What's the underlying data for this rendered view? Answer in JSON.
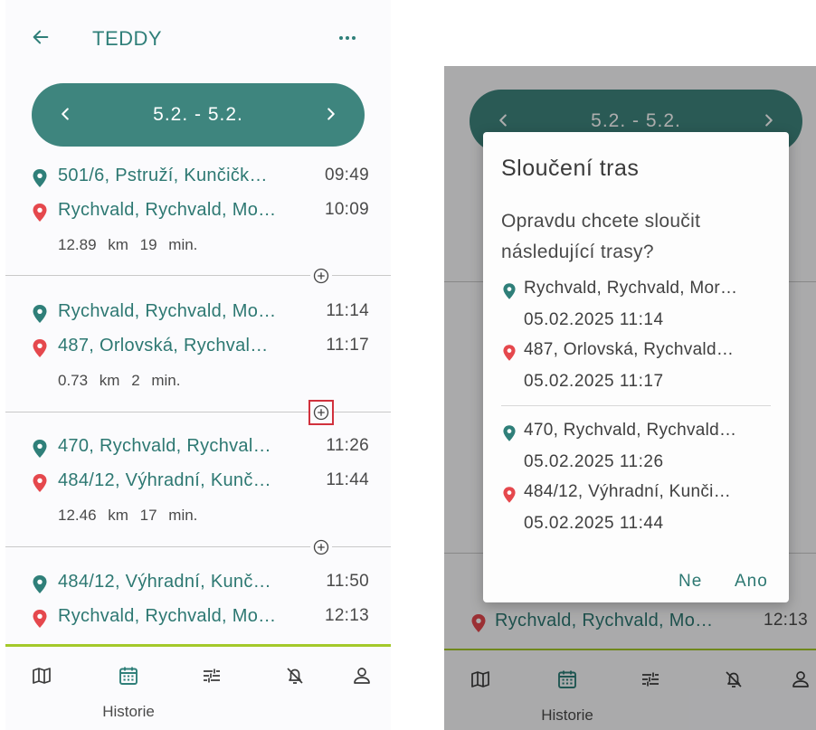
{
  "colors": {
    "primary": "#3e857e",
    "accent_green": "#a4c92a",
    "pin_start": "#2f7f79",
    "pin_end": "#e5484d",
    "highlight": "#d1313d"
  },
  "appbar": {
    "title": "TEDDY",
    "back_icon": "arrow-left-icon",
    "menu_icon": "more-horizontal-icon"
  },
  "date_range": {
    "label": "5.2. - 5.2."
  },
  "trips": [
    {
      "start_address": "501/6, Pstruží, Kunčičk…",
      "start_time": "09:49",
      "end_address": "Rychvald, Rychvald, Mo…",
      "end_time": "10:09",
      "stats": "12.89 km 19 min."
    },
    {
      "start_address": "Rychvald, Rychvald, Mo…",
      "start_time": "11:14",
      "end_address": "487, Orlovská, Rychval…",
      "end_time": "11:17",
      "stats": "0.73 km 2 min."
    },
    {
      "start_address": "470, Rychvald, Rychval…",
      "start_time": "11:26",
      "end_address": "484/12, Výhradní, Kunč…",
      "end_time": "11:44",
      "stats": "12.46 km 17 min."
    },
    {
      "start_address": "484/12, Výhradní, Kunč…",
      "start_time": "11:50",
      "end_address": "Rychvald, Rychvald, Mo…",
      "end_time": "12:13"
    }
  ],
  "bottom_nav": {
    "active_label": "Historie",
    "items": [
      "map-icon",
      "calendar-icon",
      "sliders-icon",
      "alarm-off-icon",
      "user-icon"
    ]
  },
  "dialog": {
    "title": "Sloučení tras",
    "message": "Opravdu chcete sloučit následující trasy?",
    "trip_a": {
      "start": "Rychvald, Rychvald, Mor…",
      "start_datetime": "05.02.2025 11:14",
      "end": "487, Orlovská, Rychvald…",
      "end_datetime": "05.02.2025 11:17"
    },
    "trip_b": {
      "start": "470, Rychvald, Rychvald…",
      "start_datetime": "05.02.2025 11:26",
      "end": "484/12, Výhradní, Kunči…",
      "end_datetime": "05.02.2025 11:44"
    },
    "cancel_label": "Ne",
    "confirm_label": "Ano"
  },
  "background_right": {
    "date_range": "5.2. - 5.2.",
    "visible_trip_end_address": "Rychvald, Rychvald, Mo…",
    "visible_trip_end_time": "12:13"
  }
}
